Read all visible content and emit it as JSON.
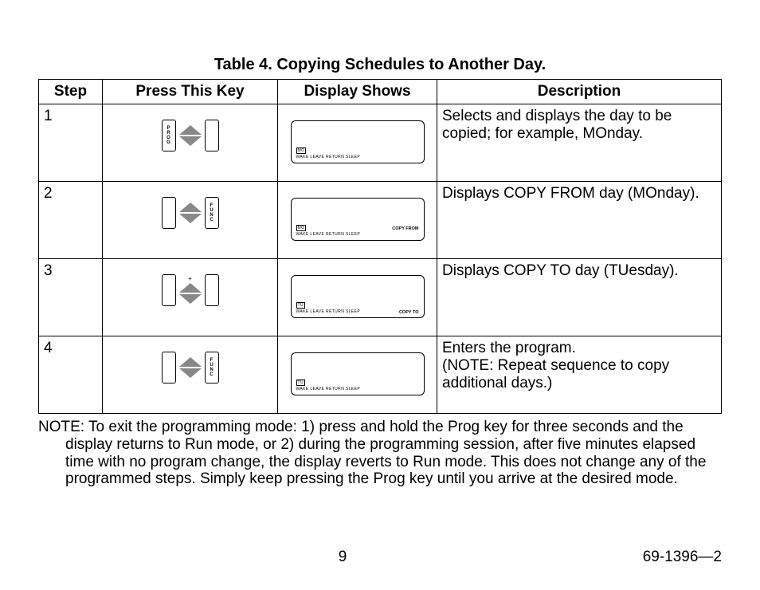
{
  "caption": "Table 4. Copying Schedules to Another Day.",
  "headers": {
    "step": "Step",
    "key": "Press This Key",
    "display": "Display Shows",
    "desc": "Description"
  },
  "rows": [
    {
      "n": "1",
      "left_btn": "PROG",
      "right_btn": "",
      "plus": false,
      "lcd_day": "MO",
      "lcd_periods": "WAKE   LEAVE   RETURN   SLEEP",
      "lcd_extra_top": "",
      "lcd_extra_bottom": "",
      "desc": "Selects and displays the day to be copied; for example, MOnday."
    },
    {
      "n": "2",
      "left_btn": "",
      "right_btn": "FUNC",
      "plus": false,
      "lcd_day": "MO",
      "lcd_periods": "WAKE   LEAVE   RETURN   SLEEP",
      "lcd_extra_top": "COPY FROM",
      "lcd_extra_bottom": "",
      "desc": "Displays COPY FROM day (MOnday)."
    },
    {
      "n": "3",
      "left_btn": "",
      "right_btn": "",
      "plus": true,
      "lcd_day": "TU",
      "lcd_periods": "WAKE   LEAVE   RETURN   SLEEP",
      "lcd_extra_top": "",
      "lcd_extra_bottom": "COPY TO",
      "desc": "Displays COPY TO day (TUesday)."
    },
    {
      "n": "4",
      "left_btn": "",
      "right_btn": "FUNC",
      "plus": false,
      "lcd_day": "TU",
      "lcd_periods": "WAKE   LEAVE   RETURN   SLEEP",
      "lcd_extra_top": "",
      "lcd_extra_bottom": "",
      "desc": "Enters the program.\n(NOTE: Repeat sequence to copy additional days.)"
    }
  ],
  "note": "NOTE: To exit the programming mode: 1) press and hold the Prog key for three seconds and the display returns to Run mode, or 2) during the programming session, after five minutes elapsed time with no program change, the display reverts to Run mode. This does not change any of the programmed steps. Simply keep pressing the Prog key until you arrive at the desired mode.",
  "footer": {
    "page": "9",
    "doc": "69-1396—2"
  }
}
